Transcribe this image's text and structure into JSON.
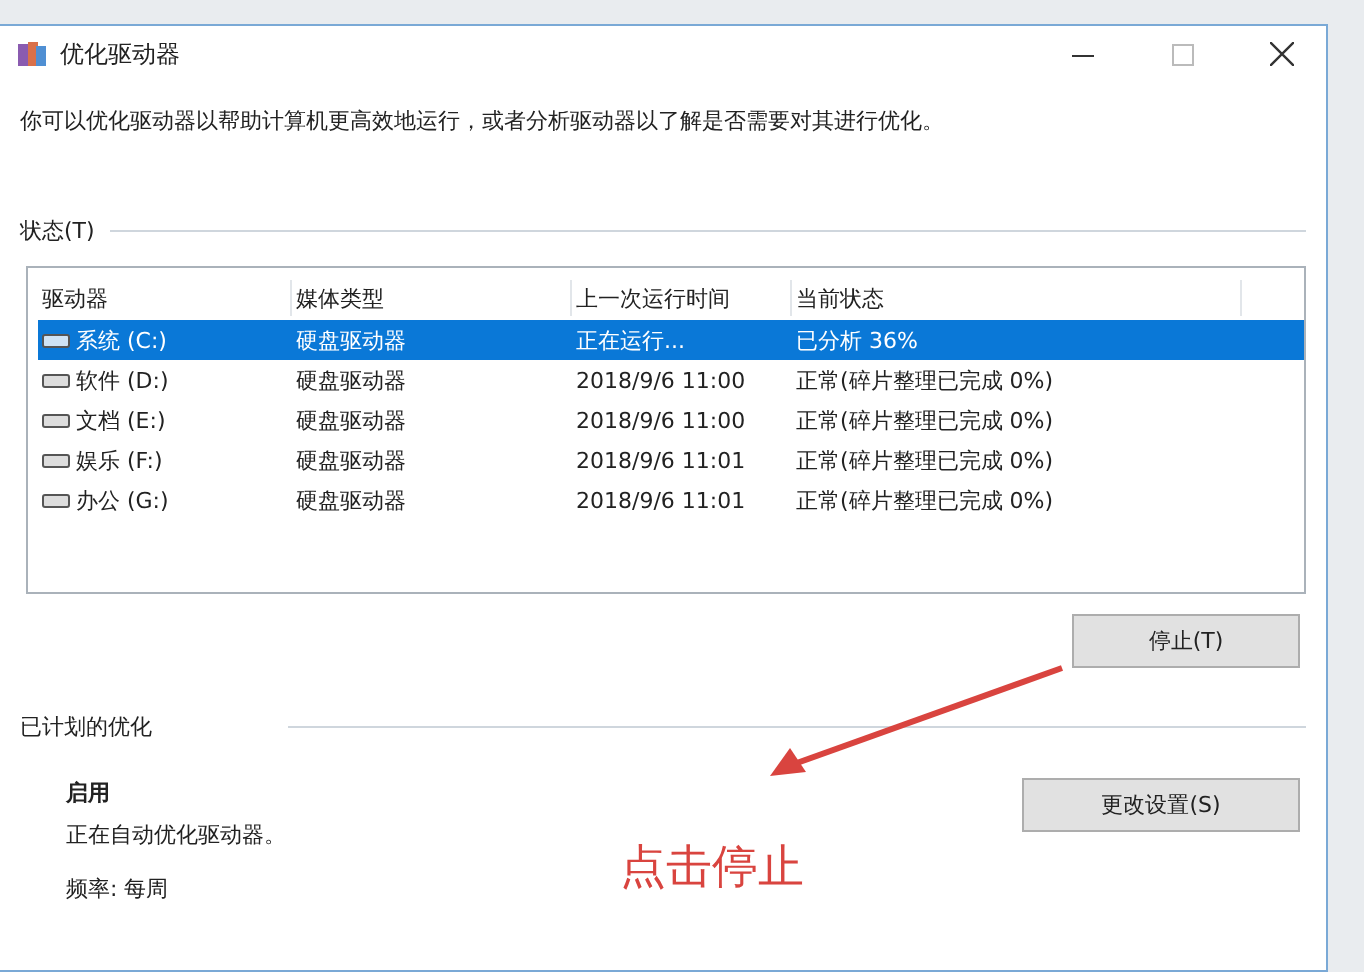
{
  "window": {
    "title": "优化驱动器"
  },
  "description": "你可以优化驱动器以帮助计算机更高效地运行，或者分析驱动器以了解是否需要对其进行优化。",
  "status_section": {
    "title": "状态(T)",
    "table": {
      "columns": [
        "驱动器",
        "媒体类型",
        "上一次运行时间",
        "当前状态"
      ],
      "rows": [
        {
          "drive": "系统 (C:)",
          "media": "硬盘驱动器",
          "last_run": "正在运行...",
          "status": "已分析 36%",
          "selected": true
        },
        {
          "drive": "软件 (D:)",
          "media": "硬盘驱动器",
          "last_run": "2018/9/6 11:00",
          "status": "正常(碎片整理已完成 0%)",
          "selected": false
        },
        {
          "drive": "文档 (E:)",
          "media": "硬盘驱动器",
          "last_run": "2018/9/6 11:00",
          "status": "正常(碎片整理已完成 0%)",
          "selected": false
        },
        {
          "drive": "娱乐 (F:)",
          "media": "硬盘驱动器",
          "last_run": "2018/9/6 11:01",
          "status": "正常(碎片整理已完成 0%)",
          "selected": false
        },
        {
          "drive": "办公 (G:)",
          "media": "硬盘驱动器",
          "last_run": "2018/9/6 11:01",
          "status": "正常(碎片整理已完成 0%)",
          "selected": false
        }
      ]
    },
    "button": "停止(T)"
  },
  "scheduled_section": {
    "title": "已计划的优化",
    "state": "启用",
    "info": "正在自动优化驱动器。",
    "frequency": "频率: 每周",
    "button": "更改设置(S)"
  },
  "annotation": {
    "text": "点击停止"
  }
}
